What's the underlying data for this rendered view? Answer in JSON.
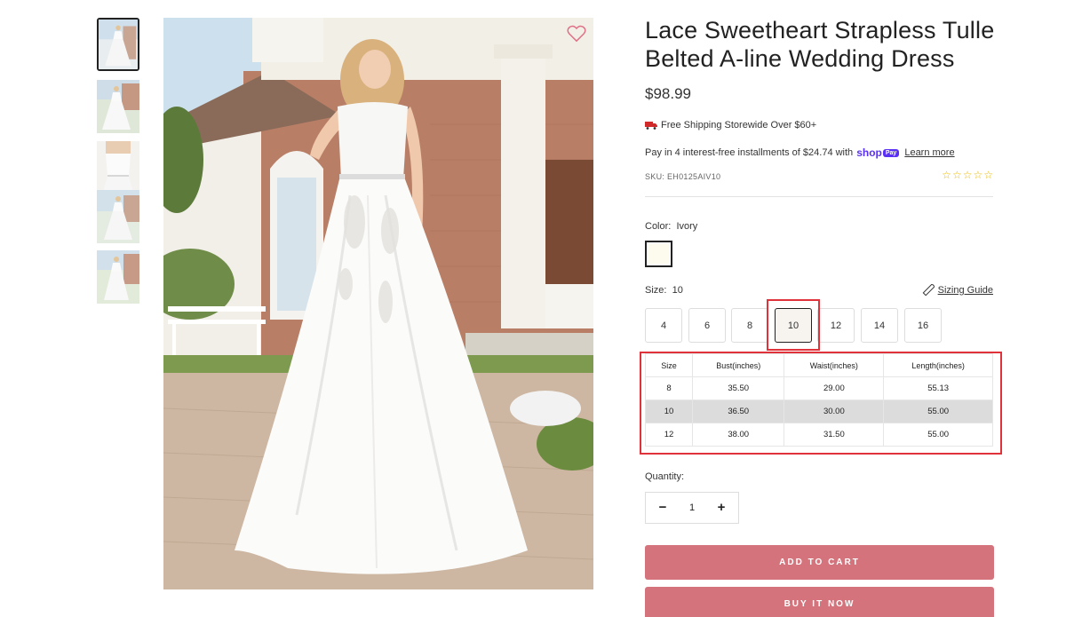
{
  "product": {
    "title": "Lace Sweetheart Strapless Tulle Belted A-line Wedding Dress",
    "price": "$98.99",
    "shipping_text": "Free Shipping Storewide Over $60+",
    "installments_text": "Pay in 4 interest-free installments of $24.74 with",
    "shop_pay_logo": "shop",
    "shop_pay_badge": "Pay",
    "learn_more": "Learn more",
    "sku": "SKU: EH0125AIV10",
    "rating_stars": 5,
    "rating_value": 0
  },
  "color": {
    "label": "Color:",
    "value": "Ivory",
    "swatch_hex": "#fdfaee"
  },
  "size": {
    "label": "Size:",
    "value": "10",
    "guide_label": "Sizing Guide",
    "options": [
      "4",
      "6",
      "8",
      "10",
      "12",
      "14",
      "16"
    ],
    "selected": "10"
  },
  "size_table": {
    "headers": [
      "Size",
      "Bust(inches)",
      "Waist(inches)",
      "Length(inches)"
    ],
    "rows": [
      [
        "8",
        "35.50",
        "29.00",
        "55.13"
      ],
      [
        "10",
        "36.50",
        "30.00",
        "55.00"
      ],
      [
        "12",
        "38.00",
        "31.50",
        "55.00"
      ]
    ]
  },
  "quantity": {
    "label": "Quantity:",
    "value": "1",
    "minus": "−",
    "plus": "+"
  },
  "actions": {
    "add_to_cart": "ADD TO CART",
    "buy_now": "BUY IT NOW"
  },
  "icons": {
    "wishlist": "heart-icon",
    "shipping": "truck-icon",
    "sizing_guide": "ruler-icon",
    "rating": "star-icon"
  },
  "colors": {
    "accent_button": "#d4737c",
    "highlight_red": "#e0323a",
    "shop_pay_purple": "#5a31f4",
    "star_yellow": "#e8b800"
  }
}
